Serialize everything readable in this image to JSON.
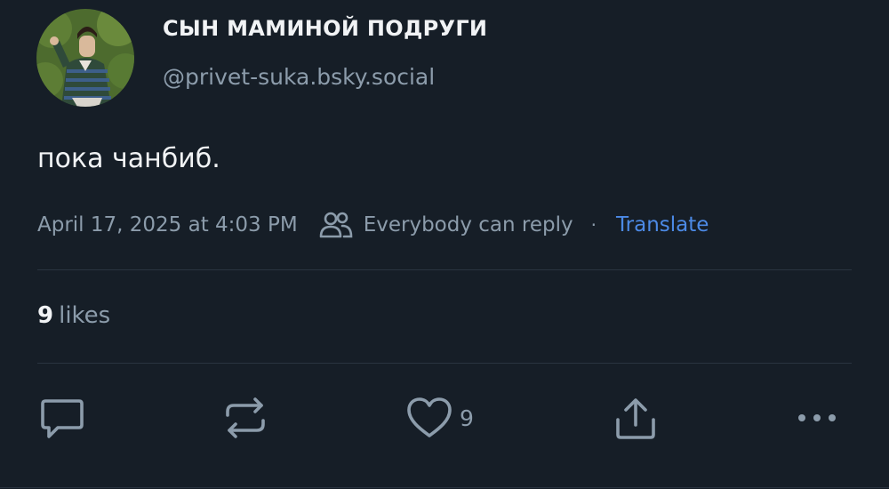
{
  "post": {
    "author": {
      "display_name": "СЫН МАМИНОЙ ПОДРУГИ",
      "handle": "@privet-suka.bsky.social"
    },
    "text": "пока чанбиб.",
    "timestamp": "April 17, 2025 at 4:03 PM",
    "reply_setting": "Everybody can reply",
    "separator": "·",
    "translate_label": "Translate",
    "stats": {
      "likes_count": "9",
      "likes_label": "likes"
    },
    "actions": {
      "like_count": "9"
    }
  },
  "colors": {
    "background": "#161e27",
    "primary_text": "#f1f3f5",
    "secondary_text": "#8c9cab",
    "link": "#4c8ae6",
    "divider": "#2a3440"
  },
  "icons": {
    "reply": "speech-bubble-icon",
    "repost": "repost-arrows-icon",
    "like": "heart-icon",
    "share": "share-upload-icon",
    "more": "more-dots-icon",
    "audience": "people-icon"
  }
}
